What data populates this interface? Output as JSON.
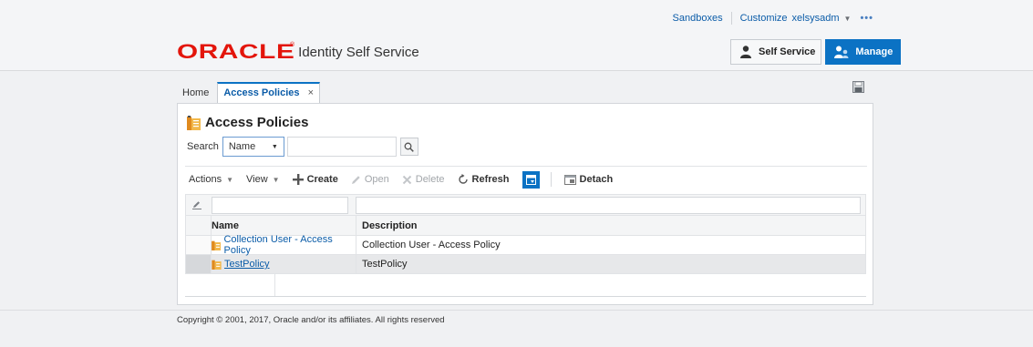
{
  "topbar": {
    "sandboxes": "Sandboxes",
    "customize": "Customize",
    "user": "xelsysadm",
    "more": "•••"
  },
  "header": {
    "brand": "ORACLE",
    "product": "Identity Self Service",
    "roles": {
      "self_service": "Self Service",
      "manage": "Manage"
    }
  },
  "tabs": [
    {
      "label": "Home"
    },
    {
      "label": "Access Policies",
      "close": "×"
    }
  ],
  "page": {
    "title": "Access Policies",
    "search_label": "Search",
    "search_field": "Name",
    "search_value": ""
  },
  "toolbar": {
    "actions": "Actions",
    "view": "View",
    "create": "Create",
    "open": "Open",
    "delete": "Delete",
    "refresh": "Refresh",
    "detach": "Detach"
  },
  "table": {
    "columns": [
      "Name",
      "Description"
    ],
    "rows": [
      {
        "name": "Collection User - Access Policy",
        "description": "Collection User - Access Policy"
      },
      {
        "name": "TestPolicy",
        "description": "TestPolicy"
      }
    ]
  },
  "footer": {
    "copyright": "Copyright © 2001, 2017, Oracle and/or its affiliates. All rights reserved"
  },
  "colors": {
    "accent": "#0b72c4",
    "brand_red": "#e3150b",
    "link": "#0b5ca8"
  }
}
